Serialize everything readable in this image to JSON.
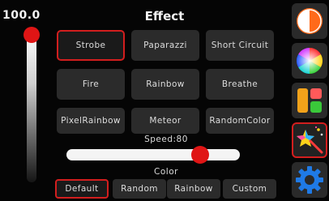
{
  "header": {
    "brightness_value": "100.0",
    "title": "Effect"
  },
  "brightness": {
    "level": 1.0
  },
  "effects": [
    {
      "label": "Strobe",
      "selected": true
    },
    {
      "label": "Paparazzi",
      "selected": false
    },
    {
      "label": "Short Circuit",
      "selected": false
    },
    {
      "label": "Fire",
      "selected": false
    },
    {
      "label": "Rainbow",
      "selected": false
    },
    {
      "label": "Breathe",
      "selected": false
    },
    {
      "label": "PixelRainbow",
      "selected": false
    },
    {
      "label": "Meteor",
      "selected": false
    },
    {
      "label": "RandomColor",
      "selected": false
    }
  ],
  "speed": {
    "label": "Speed:80",
    "value": 80,
    "max": 100
  },
  "color": {
    "label": "Color",
    "options": [
      {
        "label": "Default",
        "selected": true
      },
      {
        "label": "Random",
        "selected": false
      },
      {
        "label": "Rainbow",
        "selected": false
      },
      {
        "label": "Custom",
        "selected": false
      }
    ]
  },
  "nav": [
    {
      "icon": "contrast-icon",
      "active": false
    },
    {
      "icon": "color-wheel-icon",
      "active": false
    },
    {
      "icon": "layout-icon",
      "active": false
    },
    {
      "icon": "magic-wand-icon",
      "active": true
    },
    {
      "icon": "settings-gear-icon",
      "active": false
    }
  ],
  "colors": {
    "accent": "#d21e1e",
    "button_bg": "#2b2b2b",
    "background": "#050505"
  }
}
